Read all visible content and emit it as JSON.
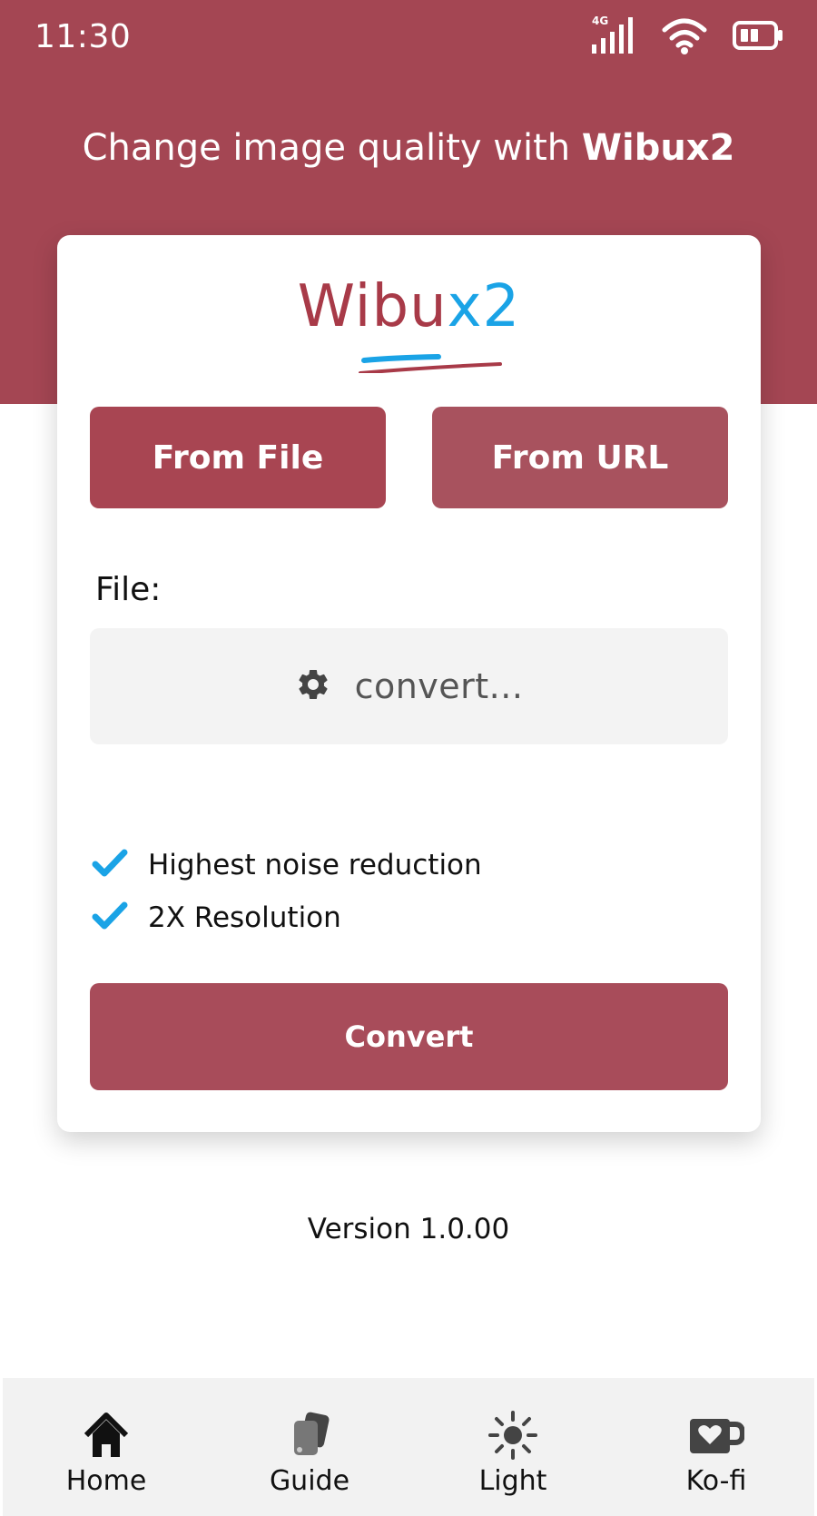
{
  "status_bar": {
    "time": "11:30",
    "network": "4G",
    "icons": [
      "signal-icon",
      "wifi-icon",
      "battery-icon"
    ]
  },
  "header": {
    "headline_prefix": "Change image quality with ",
    "headline_brand": "Wibux2",
    "background_color": "#a44653"
  },
  "logo": {
    "part_red": "Wibu",
    "part_blue": "x2",
    "red_color": "#a83a48",
    "blue_color": "#1aa3e6"
  },
  "source_tabs": {
    "from_file": "From File",
    "from_url": "From URL"
  },
  "file_section": {
    "label": "File:",
    "placeholder": "convert...",
    "icon": "gear-icon"
  },
  "options": [
    {
      "label": "Highest noise reduction",
      "checked": true
    },
    {
      "label": "2X Resolution",
      "checked": true
    }
  ],
  "convert_button": "Convert",
  "version": "Version 1.0.00",
  "bottom_nav": [
    {
      "label": "Home",
      "icon": "home-icon"
    },
    {
      "label": "Guide",
      "icon": "guide-icon"
    },
    {
      "label": "Light",
      "icon": "sun-icon"
    },
    {
      "label": "Ko-fi",
      "icon": "kofi-cup-icon"
    }
  ]
}
